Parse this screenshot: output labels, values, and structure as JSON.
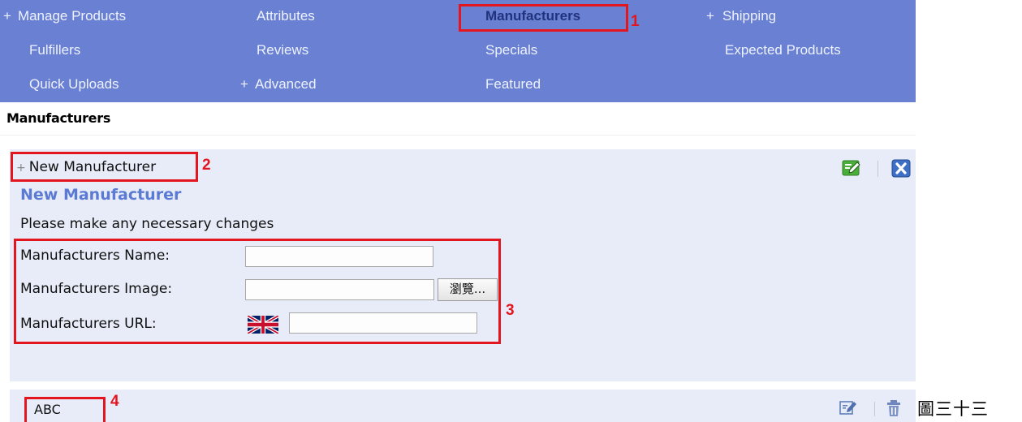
{
  "nav": {
    "items": [
      {
        "prefix": "+",
        "label": "Manage Products"
      },
      {
        "label": "Attributes"
      },
      {
        "label": "Manufacturers"
      },
      {
        "prefix": "+",
        "label": "Shipping"
      },
      {
        "label": "Fulfillers"
      },
      {
        "label": "Reviews"
      },
      {
        "label": "Specials"
      },
      {
        "label": "Expected Products"
      },
      {
        "label": "Quick Uploads"
      },
      {
        "prefix": "+",
        "label": "Advanced"
      },
      {
        "label": "Featured"
      }
    ],
    "active": "Manufacturers"
  },
  "page": {
    "title": "Manufacturers"
  },
  "panel": {
    "toggle_prefix": "+",
    "toggle_label": "New Manufacturer",
    "form_title": "New Manufacturer",
    "note": "Please make any necessary changes",
    "fields": {
      "name_label": "Manufacturers Name:",
      "name_value": "",
      "image_label": "Manufacturers Image:",
      "image_value": "",
      "browse_label": "瀏覽...",
      "url_label": "Manufacturers URL:",
      "url_value": "",
      "url_flag": "uk-flag-icon"
    },
    "icons": [
      "edit-icon",
      "close-icon"
    ]
  },
  "list": {
    "rows": [
      {
        "name": "ABC"
      }
    ],
    "icons": [
      "edit-icon",
      "delete-icon"
    ]
  },
  "annotations": [
    "1",
    "2",
    "3",
    "4"
  ],
  "caption": "圖三十三",
  "colors": {
    "nav_bg": "#6a80d2",
    "nav_text": "#eef2ff",
    "nav_active_text": "#21337d",
    "panel_bg": "#e7ecf8",
    "form_title": "#5a7ad3",
    "annotation_red": "#e3161f"
  }
}
